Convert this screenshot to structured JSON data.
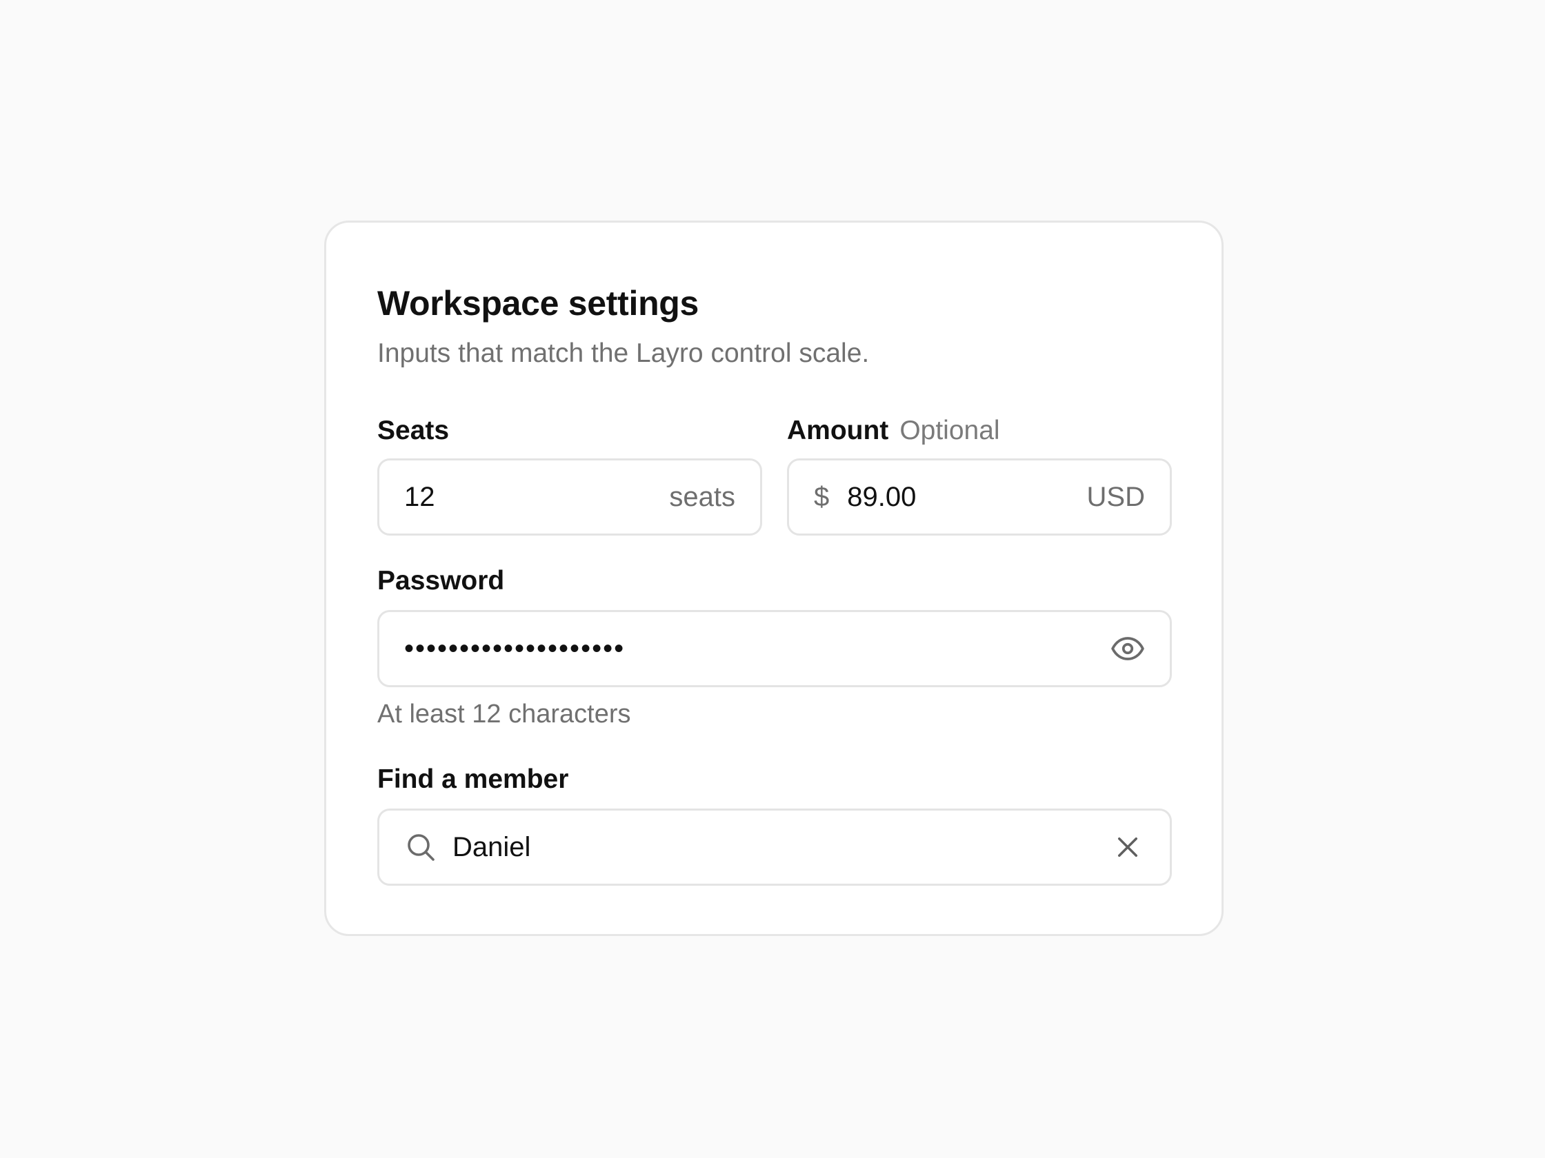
{
  "card": {
    "title": "Workspace settings",
    "subtitle": "Inputs that match the Layro control scale."
  },
  "seats": {
    "label": "Seats",
    "value": "12",
    "suffix": "seats"
  },
  "amount": {
    "label": "Amount",
    "optional": "Optional",
    "prefix": "$",
    "value": "89.00",
    "suffix": "USD"
  },
  "password": {
    "label": "Password",
    "masked_value": "••••••••••••••••••••",
    "helper": "At least 12 characters",
    "toggle_icon": "eye-icon"
  },
  "member_search": {
    "label": "Find a member",
    "value": "Daniel",
    "search_icon": "search-icon",
    "clear_icon": "close-icon"
  },
  "colors": {
    "page_background": "#fafafa",
    "card_background": "#ffffff",
    "border": "#e4e4e4",
    "text_primary": "#111111",
    "text_muted": "#707070"
  }
}
